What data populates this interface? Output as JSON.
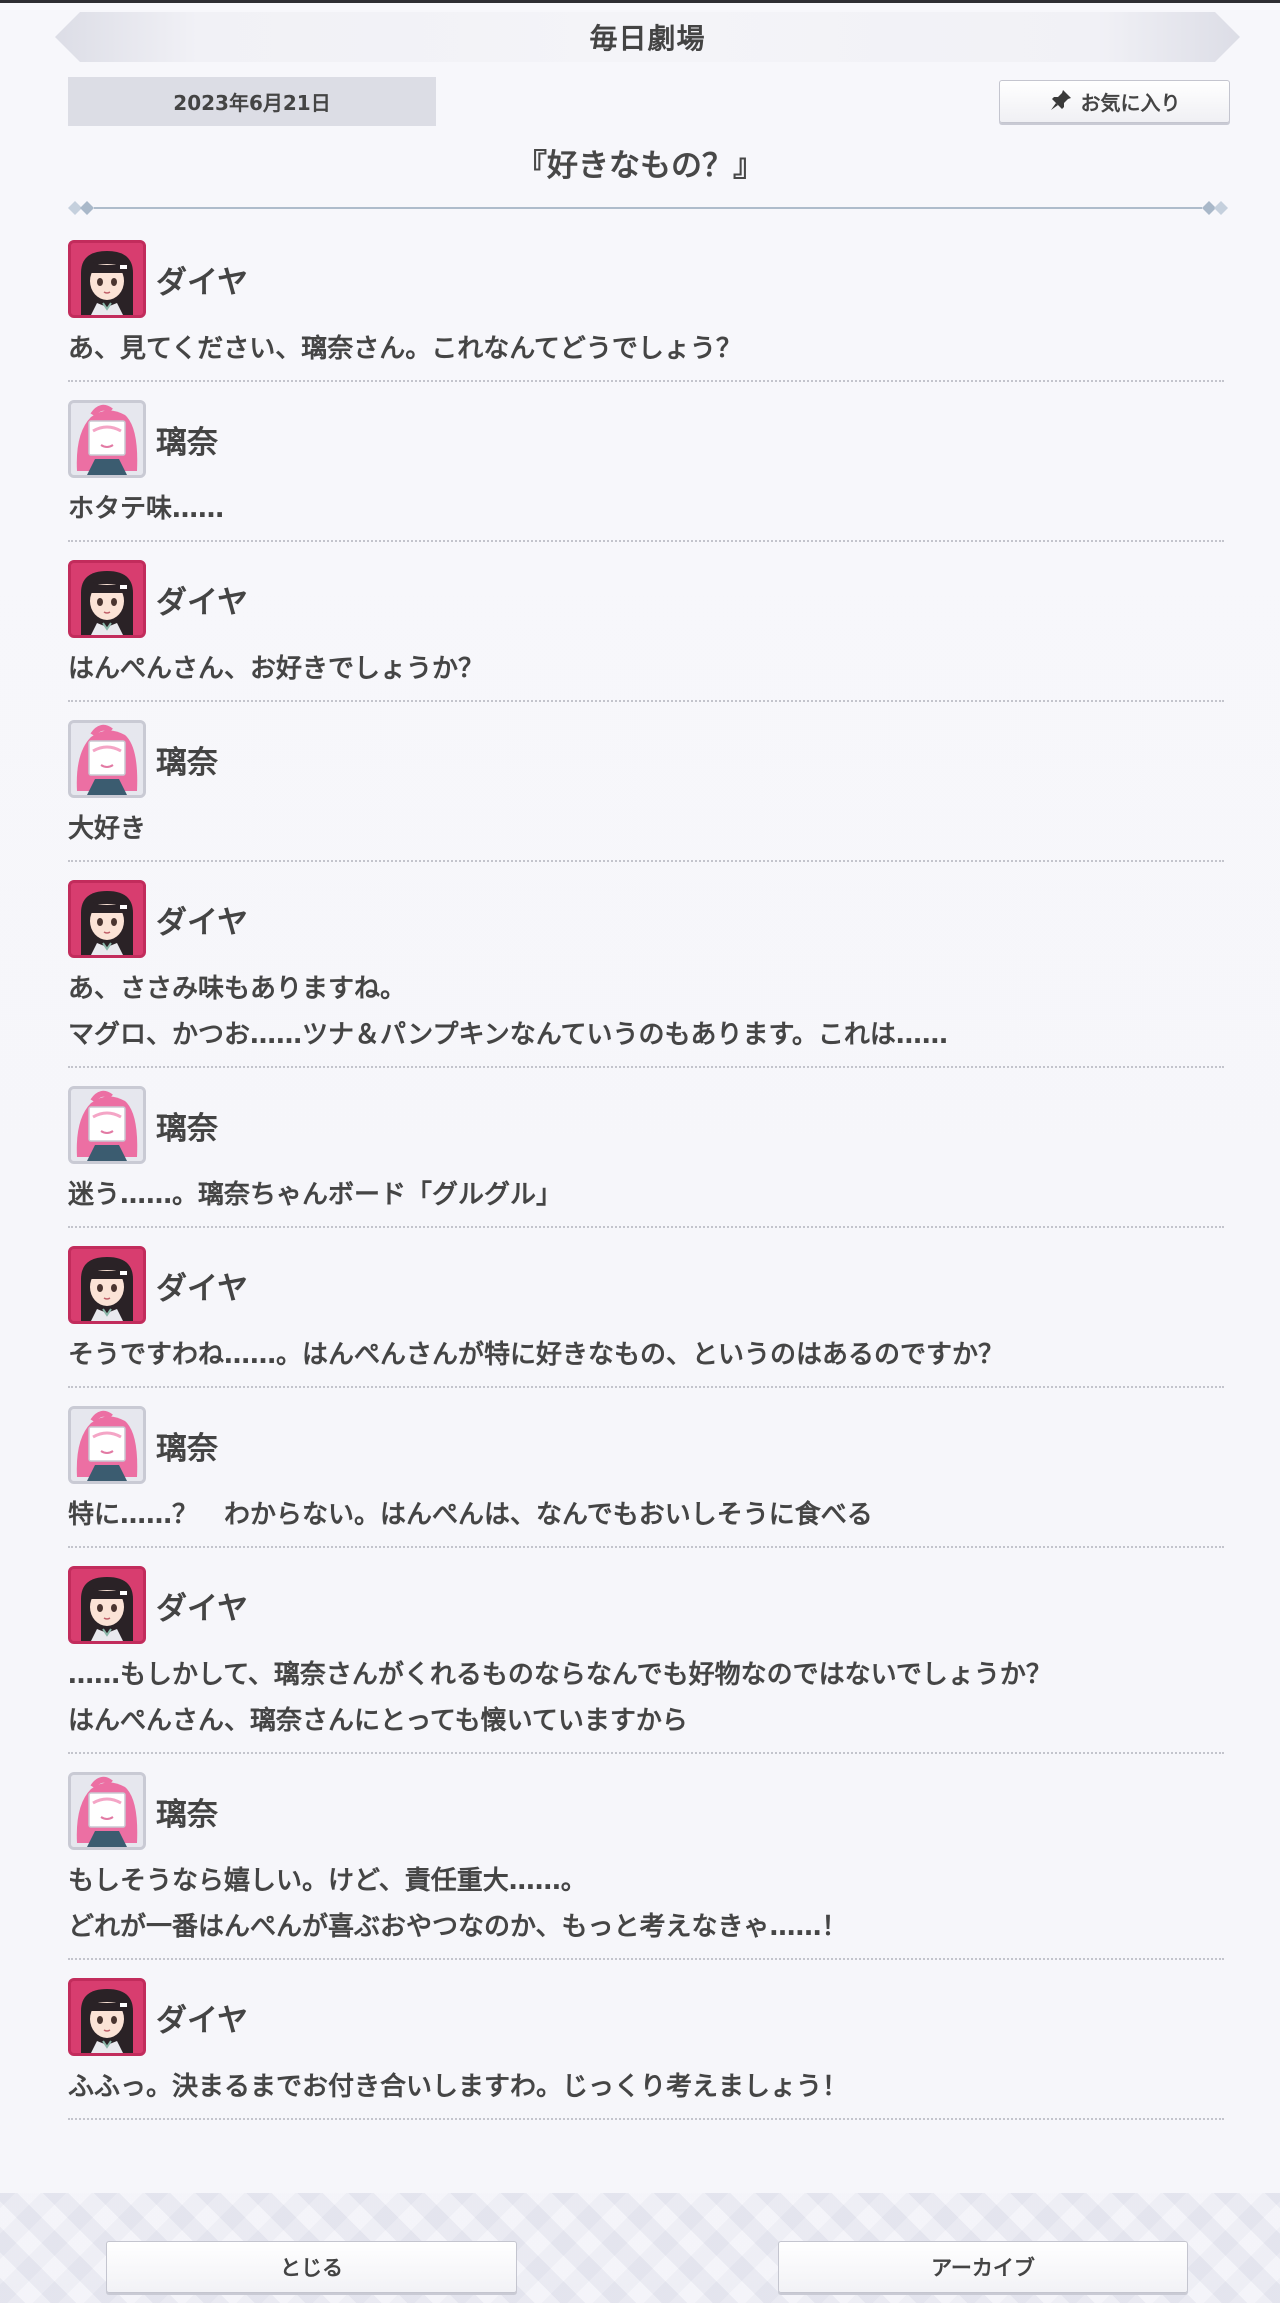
{
  "header": {
    "title": "毎日劇場"
  },
  "date": "2023年6月21日",
  "favorite_button": {
    "label": "お気に入り",
    "icon": "pin-icon"
  },
  "episode_title": "『好きなもの？』",
  "colors": {
    "dia_avatar": "#d83d6f",
    "rina_avatar": "#e6e7ee",
    "text": "#454545"
  },
  "dialogue": [
    {
      "speaker": "ダイヤ",
      "avatar": "dia",
      "lines": [
        "あ、見てください、璃奈さん。これなんてどうでしょう？"
      ]
    },
    {
      "speaker": "璃奈",
      "avatar": "rina",
      "lines": [
        "ホタテ味……"
      ]
    },
    {
      "speaker": "ダイヤ",
      "avatar": "dia",
      "lines": [
        "はんぺんさん、お好きでしょうか？"
      ]
    },
    {
      "speaker": "璃奈",
      "avatar": "rina",
      "lines": [
        "大好き"
      ]
    },
    {
      "speaker": "ダイヤ",
      "avatar": "dia",
      "lines": [
        "あ、ささみ味もありますね。",
        "マグロ、かつお……ツナ＆パンプキンなんていうのもあります。これは……"
      ]
    },
    {
      "speaker": "璃奈",
      "avatar": "rina",
      "lines": [
        "迷う……。璃奈ちゃんボード「グルグル」"
      ]
    },
    {
      "speaker": "ダイヤ",
      "avatar": "dia",
      "lines": [
        "そうですわね……。はんぺんさんが特に好きなもの、というのはあるのですか？"
      ]
    },
    {
      "speaker": "璃奈",
      "avatar": "rina",
      "lines": [
        "特に……？　わからない。はんぺんは、なんでもおいしそうに食べる"
      ]
    },
    {
      "speaker": "ダイヤ",
      "avatar": "dia",
      "lines": [
        "……もしかして、璃奈さんがくれるものならなんでも好物なのではないでしょうか？",
        "はんぺんさん、璃奈さんにとっても懐いていますから"
      ]
    },
    {
      "speaker": "璃奈",
      "avatar": "rina",
      "lines": [
        "もしそうなら嬉しい。けど、責任重大……。",
        "どれが一番はんぺんが喜ぶおやつなのか、もっと考えなきゃ……！"
      ]
    },
    {
      "speaker": "ダイヤ",
      "avatar": "dia",
      "lines": [
        "ふふっ。決まるまでお付き合いしますわ。じっくり考えましょう！"
      ]
    }
  ],
  "footer": {
    "close_label": "とじる",
    "archive_label": "アーカイブ"
  }
}
